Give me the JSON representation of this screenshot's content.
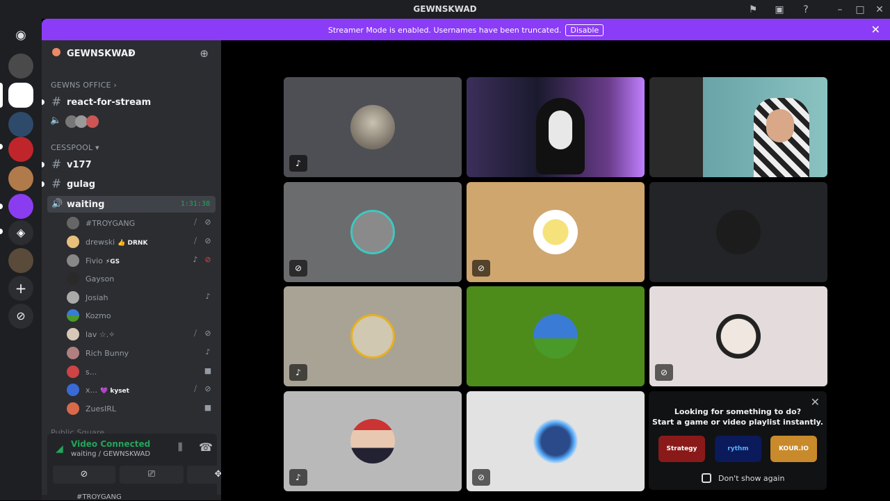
{
  "window": {
    "title": "GEWNSKWAD"
  },
  "banner": {
    "message": "Streamer Mode is enabled. Usernames have been truncated.",
    "disable_label": "Disable"
  },
  "server": {
    "name": "GEWNSKWAD"
  },
  "categories": {
    "office": "GEWNS OFFICE",
    "cesspool": "CESSPOOL",
    "public": "Public Square"
  },
  "channels": {
    "react": "react-for-stream",
    "v177": "v177",
    "gulag": "gulag",
    "waiting": "waiting",
    "waiting_timer": "1:31:38"
  },
  "members": [
    {
      "name": "#TROYGANG",
      "badge": ""
    },
    {
      "name": "drewski",
      "badge": "👍 DRNK"
    },
    {
      "name": "Fivio",
      "badge": "⚡GS"
    },
    {
      "name": "Gayson",
      "badge": ""
    },
    {
      "name": "Josiah",
      "badge": ""
    },
    {
      "name": "Kozmo",
      "badge": ""
    },
    {
      "name": "lav ☆.✧",
      "badge": ""
    },
    {
      "name": "Rich Bunny",
      "badge": ""
    },
    {
      "name": "s...",
      "badge": ""
    },
    {
      "name": "x...",
      "badge": "💜 kyset"
    },
    {
      "name": "ZuesIRL",
      "badge": ""
    }
  ],
  "rtc": {
    "status": "Video Connected",
    "location": "waiting / GEWNSKWAD",
    "bottom_user": "#TROYGANG"
  },
  "promo": {
    "line1": "Looking for something to do?",
    "line2": "Start a game or video playlist instantly.",
    "games": [
      "Strategy",
      "rythm",
      "KOUR.IO"
    ],
    "dont_show": "Don't show again"
  }
}
